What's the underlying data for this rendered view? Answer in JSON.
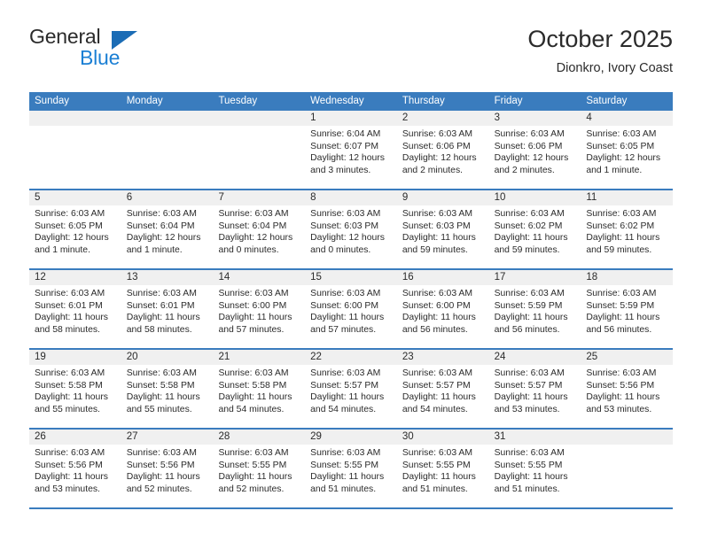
{
  "logo": {
    "text_top": "General",
    "text_bottom": "Blue",
    "triangle_color": "#1b6cb5",
    "blue_color": "#1b7fd4"
  },
  "header": {
    "month_title": "October 2025",
    "location": "Dionkro, Ivory Coast"
  },
  "theme": {
    "header_blue": "#3a7cbe",
    "day_number_bg": "#f0f0f0",
    "text_color": "#2b2b2b"
  },
  "calendar": {
    "weekdays": [
      "Sunday",
      "Monday",
      "Tuesday",
      "Wednesday",
      "Thursday",
      "Friday",
      "Saturday"
    ],
    "weeks": [
      [
        {
          "day": "",
          "lines": []
        },
        {
          "day": "",
          "lines": []
        },
        {
          "day": "",
          "lines": []
        },
        {
          "day": "1",
          "lines": [
            "Sunrise: 6:04 AM",
            "Sunset: 6:07 PM",
            "Daylight: 12 hours",
            "and 3 minutes."
          ]
        },
        {
          "day": "2",
          "lines": [
            "Sunrise: 6:03 AM",
            "Sunset: 6:06 PM",
            "Daylight: 12 hours",
            "and 2 minutes."
          ]
        },
        {
          "day": "3",
          "lines": [
            "Sunrise: 6:03 AM",
            "Sunset: 6:06 PM",
            "Daylight: 12 hours",
            "and 2 minutes."
          ]
        },
        {
          "day": "4",
          "lines": [
            "Sunrise: 6:03 AM",
            "Sunset: 6:05 PM",
            "Daylight: 12 hours",
            "and 1 minute."
          ]
        }
      ],
      [
        {
          "day": "5",
          "lines": [
            "Sunrise: 6:03 AM",
            "Sunset: 6:05 PM",
            "Daylight: 12 hours",
            "and 1 minute."
          ]
        },
        {
          "day": "6",
          "lines": [
            "Sunrise: 6:03 AM",
            "Sunset: 6:04 PM",
            "Daylight: 12 hours",
            "and 1 minute."
          ]
        },
        {
          "day": "7",
          "lines": [
            "Sunrise: 6:03 AM",
            "Sunset: 6:04 PM",
            "Daylight: 12 hours",
            "and 0 minutes."
          ]
        },
        {
          "day": "8",
          "lines": [
            "Sunrise: 6:03 AM",
            "Sunset: 6:03 PM",
            "Daylight: 12 hours",
            "and 0 minutes."
          ]
        },
        {
          "day": "9",
          "lines": [
            "Sunrise: 6:03 AM",
            "Sunset: 6:03 PM",
            "Daylight: 11 hours",
            "and 59 minutes."
          ]
        },
        {
          "day": "10",
          "lines": [
            "Sunrise: 6:03 AM",
            "Sunset: 6:02 PM",
            "Daylight: 11 hours",
            "and 59 minutes."
          ]
        },
        {
          "day": "11",
          "lines": [
            "Sunrise: 6:03 AM",
            "Sunset: 6:02 PM",
            "Daylight: 11 hours",
            "and 59 minutes."
          ]
        }
      ],
      [
        {
          "day": "12",
          "lines": [
            "Sunrise: 6:03 AM",
            "Sunset: 6:01 PM",
            "Daylight: 11 hours",
            "and 58 minutes."
          ]
        },
        {
          "day": "13",
          "lines": [
            "Sunrise: 6:03 AM",
            "Sunset: 6:01 PM",
            "Daylight: 11 hours",
            "and 58 minutes."
          ]
        },
        {
          "day": "14",
          "lines": [
            "Sunrise: 6:03 AM",
            "Sunset: 6:00 PM",
            "Daylight: 11 hours",
            "and 57 minutes."
          ]
        },
        {
          "day": "15",
          "lines": [
            "Sunrise: 6:03 AM",
            "Sunset: 6:00 PM",
            "Daylight: 11 hours",
            "and 57 minutes."
          ]
        },
        {
          "day": "16",
          "lines": [
            "Sunrise: 6:03 AM",
            "Sunset: 6:00 PM",
            "Daylight: 11 hours",
            "and 56 minutes."
          ]
        },
        {
          "day": "17",
          "lines": [
            "Sunrise: 6:03 AM",
            "Sunset: 5:59 PM",
            "Daylight: 11 hours",
            "and 56 minutes."
          ]
        },
        {
          "day": "18",
          "lines": [
            "Sunrise: 6:03 AM",
            "Sunset: 5:59 PM",
            "Daylight: 11 hours",
            "and 56 minutes."
          ]
        }
      ],
      [
        {
          "day": "19",
          "lines": [
            "Sunrise: 6:03 AM",
            "Sunset: 5:58 PM",
            "Daylight: 11 hours",
            "and 55 minutes."
          ]
        },
        {
          "day": "20",
          "lines": [
            "Sunrise: 6:03 AM",
            "Sunset: 5:58 PM",
            "Daylight: 11 hours",
            "and 55 minutes."
          ]
        },
        {
          "day": "21",
          "lines": [
            "Sunrise: 6:03 AM",
            "Sunset: 5:58 PM",
            "Daylight: 11 hours",
            "and 54 minutes."
          ]
        },
        {
          "day": "22",
          "lines": [
            "Sunrise: 6:03 AM",
            "Sunset: 5:57 PM",
            "Daylight: 11 hours",
            "and 54 minutes."
          ]
        },
        {
          "day": "23",
          "lines": [
            "Sunrise: 6:03 AM",
            "Sunset: 5:57 PM",
            "Daylight: 11 hours",
            "and 54 minutes."
          ]
        },
        {
          "day": "24",
          "lines": [
            "Sunrise: 6:03 AM",
            "Sunset: 5:57 PM",
            "Daylight: 11 hours",
            "and 53 minutes."
          ]
        },
        {
          "day": "25",
          "lines": [
            "Sunrise: 6:03 AM",
            "Sunset: 5:56 PM",
            "Daylight: 11 hours",
            "and 53 minutes."
          ]
        }
      ],
      [
        {
          "day": "26",
          "lines": [
            "Sunrise: 6:03 AM",
            "Sunset: 5:56 PM",
            "Daylight: 11 hours",
            "and 53 minutes."
          ]
        },
        {
          "day": "27",
          "lines": [
            "Sunrise: 6:03 AM",
            "Sunset: 5:56 PM",
            "Daylight: 11 hours",
            "and 52 minutes."
          ]
        },
        {
          "day": "28",
          "lines": [
            "Sunrise: 6:03 AM",
            "Sunset: 5:55 PM",
            "Daylight: 11 hours",
            "and 52 minutes."
          ]
        },
        {
          "day": "29",
          "lines": [
            "Sunrise: 6:03 AM",
            "Sunset: 5:55 PM",
            "Daylight: 11 hours",
            "and 51 minutes."
          ]
        },
        {
          "day": "30",
          "lines": [
            "Sunrise: 6:03 AM",
            "Sunset: 5:55 PM",
            "Daylight: 11 hours",
            "and 51 minutes."
          ]
        },
        {
          "day": "31",
          "lines": [
            "Sunrise: 6:03 AM",
            "Sunset: 5:55 PM",
            "Daylight: 11 hours",
            "and 51 minutes."
          ]
        },
        {
          "day": "",
          "lines": []
        }
      ]
    ]
  }
}
